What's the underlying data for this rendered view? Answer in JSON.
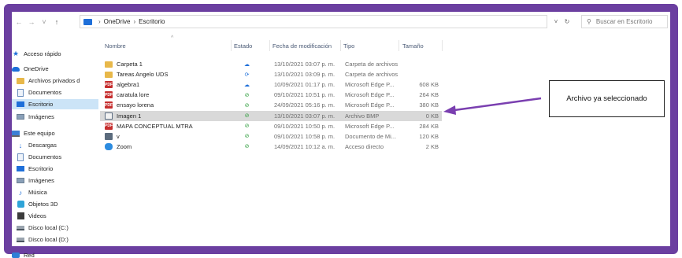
{
  "address": {
    "crumbs": [
      "OneDrive",
      "Escritorio"
    ],
    "search_placeholder": "Buscar en Escritorio"
  },
  "sidebar": {
    "items": [
      {
        "label": "Acceso rápido",
        "icon": "star-icon"
      },
      {
        "label": "OneDrive",
        "icon": "cloud-icon"
      },
      {
        "label": "Archivos privados d",
        "icon": "folder-icon"
      },
      {
        "label": "Documentos",
        "icon": "document-icon"
      },
      {
        "label": "Escritorio",
        "icon": "desktop-icon"
      },
      {
        "label": "Imágenes",
        "icon": "images-icon"
      },
      {
        "label": "Este equipo",
        "icon": "computer-icon"
      },
      {
        "label": "Descargas",
        "icon": "download-icon"
      },
      {
        "label": "Documentos",
        "icon": "document-icon"
      },
      {
        "label": "Escritorio",
        "icon": "desktop-icon"
      },
      {
        "label": "Imágenes",
        "icon": "images-icon"
      },
      {
        "label": "Música",
        "icon": "music-icon"
      },
      {
        "label": "Objetos 3D",
        "icon": "objects-3d-icon"
      },
      {
        "label": "Videos",
        "icon": "video-icon"
      },
      {
        "label": "Disco local (C:)",
        "icon": "disk-icon"
      },
      {
        "label": "Disco local (D:)",
        "icon": "disk-icon"
      },
      {
        "label": "Red",
        "icon": "network-icon"
      }
    ]
  },
  "columns": {
    "name": "Nombre",
    "status": "Estado",
    "modified": "Fecha de modificación",
    "type": "Tipo",
    "size": "Tamaño"
  },
  "files": [
    {
      "name": "Carpeta 1",
      "kind": "folder",
      "status": "cloud",
      "modified": "13/10/2021 03:07 p. m.",
      "type": "Carpeta de archivos",
      "size": ""
    },
    {
      "name": "Tareas Angelo UDS",
      "kind": "folder",
      "status": "sync",
      "modified": "13/10/2021 03:09 p. m.",
      "type": "Carpeta de archivos",
      "size": ""
    },
    {
      "name": "algebra1",
      "kind": "pdf",
      "status": "cloud",
      "modified": "10/09/2021 01:17 p. m.",
      "type": "Microsoft Edge P...",
      "size": "608 KB"
    },
    {
      "name": "caratula lore",
      "kind": "pdf",
      "status": "ok",
      "modified": "09/10/2021 10:51 p. m.",
      "type": "Microsoft Edge P...",
      "size": "264 KB"
    },
    {
      "name": "ensayo lorena",
      "kind": "pdf",
      "status": "ok",
      "modified": "24/09/2021 05:16 p. m.",
      "type": "Microsoft Edge P...",
      "size": "380 KB"
    },
    {
      "name": "Imagen 1",
      "kind": "bmp",
      "status": "ok",
      "modified": "13/10/2021 03:07 p. m.",
      "type": "Archivo BMP",
      "size": "0 KB"
    },
    {
      "name": "MAPA CONCEPTUAL MTRA",
      "kind": "pdf",
      "status": "ok",
      "modified": "09/10/2021 10:50 p. m.",
      "type": "Microsoft Edge P...",
      "size": "284 KB"
    },
    {
      "name": "v",
      "kind": "word",
      "status": "ok",
      "modified": "09/10/2021 10:58 p. m.",
      "type": "Documento de Mi...",
      "size": "120 KB"
    },
    {
      "name": "Zoom",
      "kind": "link",
      "status": "ok",
      "modified": "14/09/2021 10:12 a. m.",
      "type": "Acceso directo",
      "size": "2 KB"
    }
  ],
  "callout": {
    "text": "Archivo ya seleccionado"
  },
  "colors": {
    "frame": "#6b3fa0",
    "arrow": "#7a3fb0",
    "selection": "#cce4f7",
    "selected_row": "#d9d9d9",
    "accent": "#1e6fd9"
  }
}
